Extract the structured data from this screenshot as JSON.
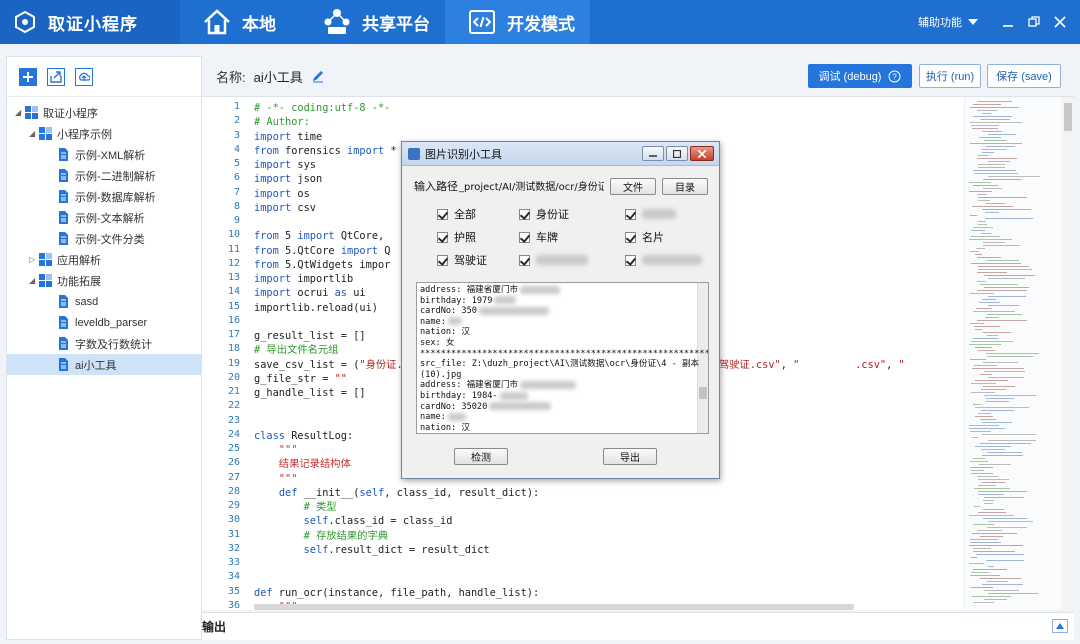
{
  "app": {
    "title": "取证小程序",
    "tabs": [
      {
        "label": "本地",
        "icon": "home-icon"
      },
      {
        "label": "共享平台",
        "icon": "share-network-icon"
      },
      {
        "label": "开发模式",
        "icon": "code-icon",
        "active": true
      }
    ],
    "assist_label": "辅助功能",
    "accent": "#1f6fd1"
  },
  "tree": [
    {
      "label": "取证小程序",
      "level": 0,
      "type": "folder",
      "expanded": true
    },
    {
      "label": "小程序示例",
      "level": 1,
      "type": "folder",
      "expanded": true
    },
    {
      "label": "示例-XML解析",
      "level": 2,
      "type": "file"
    },
    {
      "label": "示例-二进制解析",
      "level": 2,
      "type": "file"
    },
    {
      "label": "示例-数据库解析",
      "level": 2,
      "type": "file"
    },
    {
      "label": "示例-文本解析",
      "level": 2,
      "type": "file"
    },
    {
      "label": "示例-文件分类",
      "level": 2,
      "type": "file"
    },
    {
      "label": "应用解析",
      "level": 1,
      "type": "folder",
      "expanded": false
    },
    {
      "label": "功能拓展",
      "level": 1,
      "type": "folder",
      "expanded": true
    },
    {
      "label": "sasd",
      "level": 2,
      "type": "file"
    },
    {
      "label": "leveldb_parser",
      "level": 2,
      "type": "file"
    },
    {
      "label": "字数及行数统计",
      "level": 2,
      "type": "file"
    },
    {
      "label": "ai小工具",
      "level": 2,
      "type": "file",
      "selected": true
    }
  ],
  "header": {
    "name_label": "名称:",
    "name_value": "ai小工具",
    "debug_button": "调试 (debug)",
    "run_button": "执行 (run)",
    "save_button": "保存 (save)"
  },
  "editor": {
    "lines": [
      {
        "n": "1",
        "t": "# -*- coding:utf-8 -*-"
      },
      {
        "n": "2",
        "t": "# Author:"
      },
      {
        "n": "3",
        "t": "import time"
      },
      {
        "n": "4",
        "t": "from forensics import *"
      },
      {
        "n": "5",
        "t": "import sys"
      },
      {
        "n": "6",
        "t": "import json"
      },
      {
        "n": "7",
        "t": "import os"
      },
      {
        "n": "8",
        "t": "import csv"
      },
      {
        "n": "9",
        "t": ""
      },
      {
        "n": "10",
        "t": "from PyQt5 import QtCore,"
      },
      {
        "n": "11",
        "t": "from PyQt5.QtCore import Q"
      },
      {
        "n": "12",
        "t": "from PyQt5.QtWidgets impor"
      },
      {
        "n": "13",
        "t": "import importlib"
      },
      {
        "n": "14",
        "t": "import ocrui as ui"
      },
      {
        "n": "15",
        "t": "importlib.reload(ui)"
      },
      {
        "n": "16",
        "t": ""
      },
      {
        "n": "17",
        "t": "g_result_list = []"
      },
      {
        "n": "18",
        "t": "# 导出文件名元组"
      },
      {
        "n": "19",
        "t": "save_csv_list = (\"身份证.c                                                  驾驶证.csv\", \"         .csv\", \""
      },
      {
        "n": "20",
        "t": "g_file_str = \"\""
      },
      {
        "n": "21",
        "t": "g_handle_list = []"
      },
      {
        "n": "22",
        "t": ""
      },
      {
        "n": "23",
        "t": ""
      },
      {
        "n": "24",
        "t": "class ResultLog:"
      },
      {
        "n": "25",
        "t": "    \"\"\""
      },
      {
        "n": "26",
        "t": "    结果记录结构体"
      },
      {
        "n": "27",
        "t": "    \"\"\""
      },
      {
        "n": "28",
        "t": "    def __init__(self, class_id, result_dict):"
      },
      {
        "n": "29",
        "t": "        # 类型"
      },
      {
        "n": "30",
        "t": "        self.class_id = class_id"
      },
      {
        "n": "31",
        "t": "        # 存放结果的字典"
      },
      {
        "n": "32",
        "t": "        self.result_dict = result_dict"
      },
      {
        "n": "33",
        "t": ""
      },
      {
        "n": "34",
        "t": ""
      },
      {
        "n": "35",
        "t": "def run_ocr(instance, file_path, handle_list):"
      },
      {
        "n": "36",
        "t": "    \"\"\""
      }
    ]
  },
  "output": {
    "label": "输出"
  },
  "dialog": {
    "title": "图片识别小工具",
    "path_label": "输入路径",
    "path_value": "_project/AI/测试数据/ocr/身份证",
    "file_button": "文件",
    "dir_button": "目录",
    "checkboxes": [
      "全部",
      "身份证",
      "",
      "护照",
      "车牌",
      "名片",
      "驾驶证",
      "",
      ""
    ],
    "result_lines": [
      "address: 福建省厦门市",
      "birthday: 1979",
      "cardNo: 350",
      "name:",
      "nation: 汉",
      "sex: 女",
      "********************************************************",
      "src_file: Z:\\duzh_project\\AI\\测试数据\\ocr\\身份证\\4 - 副本",
      "(10).jpg",
      "address: 福建省厦门市",
      "birthday: 1984-",
      "cardNo: 35020",
      "name:",
      "nation: 汉"
    ],
    "detect_button": "检测",
    "export_button": "导出"
  }
}
